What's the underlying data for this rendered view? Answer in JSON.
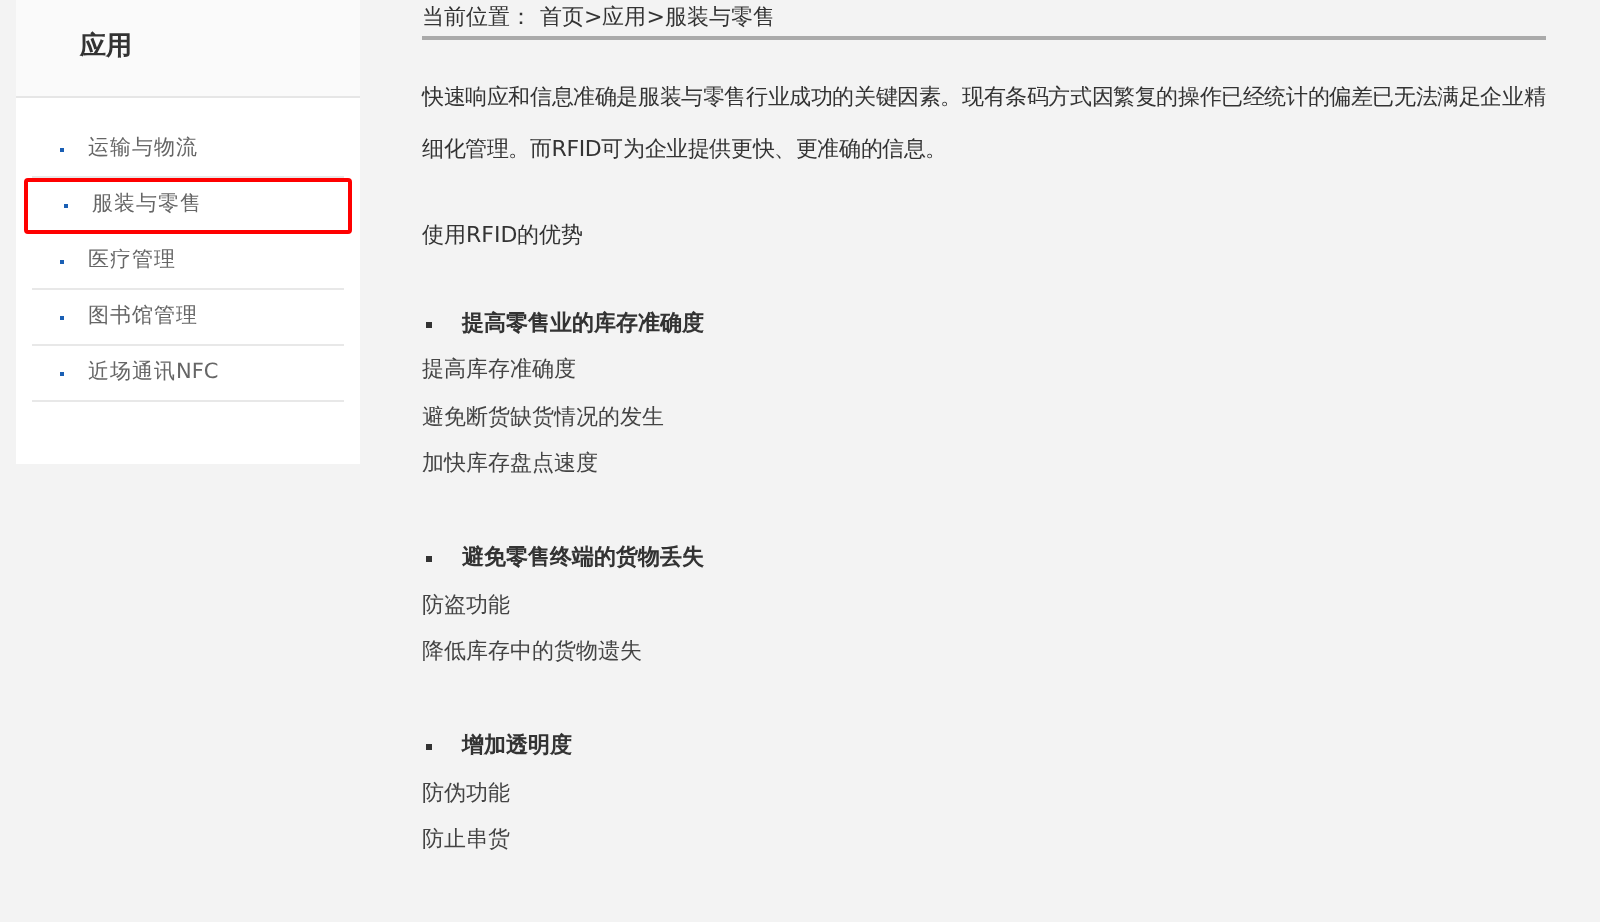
{
  "sidebar": {
    "title": "应用",
    "items": [
      {
        "label": "运输与物流",
        "highlighted": false
      },
      {
        "label": "服装与零售",
        "highlighted": true
      },
      {
        "label": "医疗管理",
        "highlighted": false
      },
      {
        "label": "图书馆管理",
        "highlighted": false
      },
      {
        "label": "近场通讯NFC",
        "highlighted": false
      }
    ]
  },
  "breadcrumb": {
    "label": "当前位置：",
    "path": "首页>应用>服装与零售"
  },
  "intro": "快速响应和信息准确是服装与零售行业成功的关键因素。现有条码方式因繁复的操作已经统计的偏差已无法满足企业精细化管理。而RFID可为企业提供更快、更准确的信息。",
  "subtitle": "使用RFID的优势",
  "sections": [
    {
      "heading": "提高零售业的库存准确度",
      "items": [
        "提高库存准确度",
        "避免断货缺货情况的发生",
        "加快库存盘点速度"
      ]
    },
    {
      "heading": "避免零售终端的货物丢失",
      "items": [
        "防盗功能",
        "降低库存中的货物遗失"
      ]
    },
    {
      "heading": "增加透明度",
      "items": [
        "防伪功能",
        "防止串货"
      ]
    }
  ]
}
